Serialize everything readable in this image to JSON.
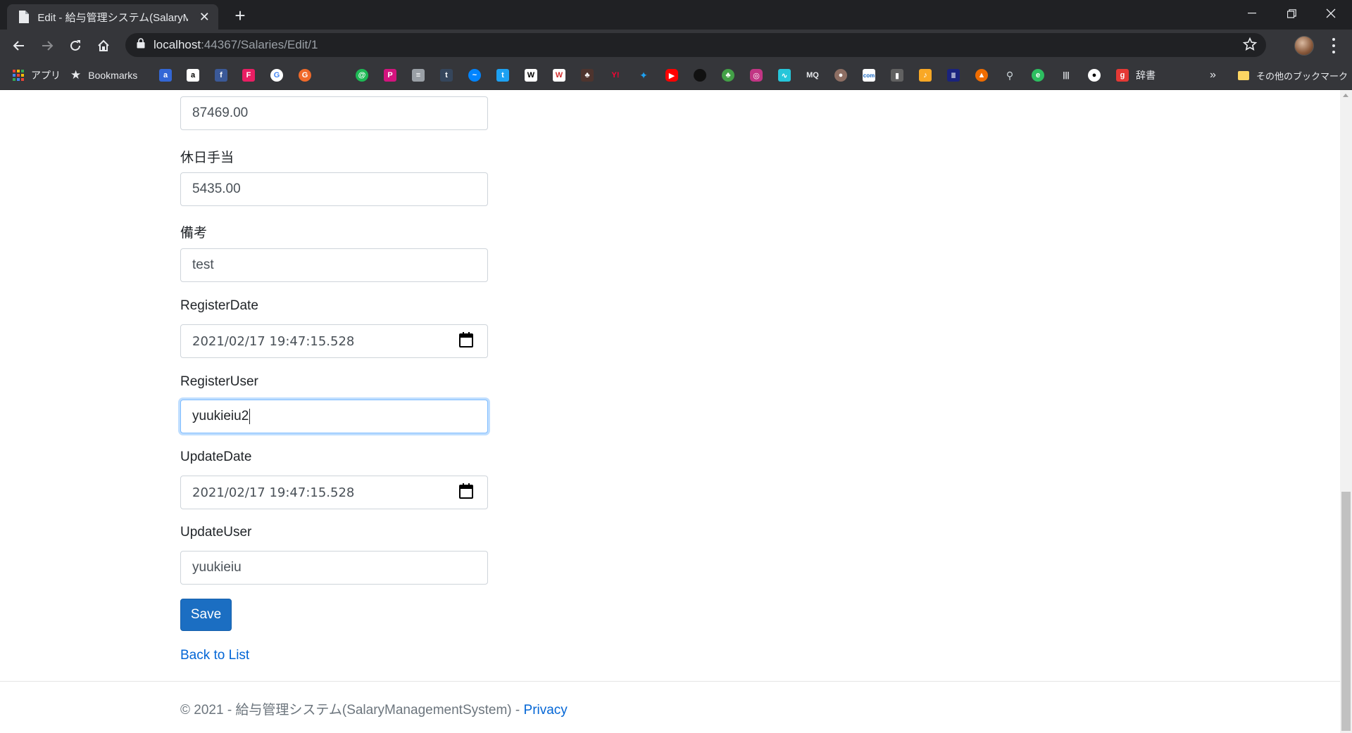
{
  "browser": {
    "tab_title": "Edit - 給与管理システム(SalaryManagementSystem)",
    "new_tab": "+",
    "url_host": "localhost",
    "url_rest": ":44367/Salaries/Edit/1",
    "bookmarks": {
      "apps_label": "アプリ",
      "bookmarks_label": "Bookmarks",
      "dict_label": "辞書",
      "overflow": "»",
      "other_label": "その他のブックマーク"
    }
  },
  "form": {
    "fields": [
      {
        "label": "",
        "value": "87469.00"
      },
      {
        "label": "休日手当",
        "value": "5435.00"
      },
      {
        "label": "備考",
        "value": "test"
      },
      {
        "label": "RegisterDate",
        "value": "2021/02/17  19:47:15.528"
      },
      {
        "label": "RegisterUser",
        "value": "yuukieiu2"
      },
      {
        "label": "UpdateDate",
        "value": "2021/02/17  19:47:15.528"
      },
      {
        "label": "UpdateUser",
        "value": "yuukieiu"
      }
    ],
    "save_label": "Save",
    "back_label": "Back to List"
  },
  "footer": {
    "copyright": "© 2021 - 給与管理システム(SalaryManagementSystem) - ",
    "privacy": "Privacy"
  },
  "colors": {
    "primary_button": "#1b6ec2",
    "link": "#0366d6",
    "focus_border": "#80bdff"
  }
}
